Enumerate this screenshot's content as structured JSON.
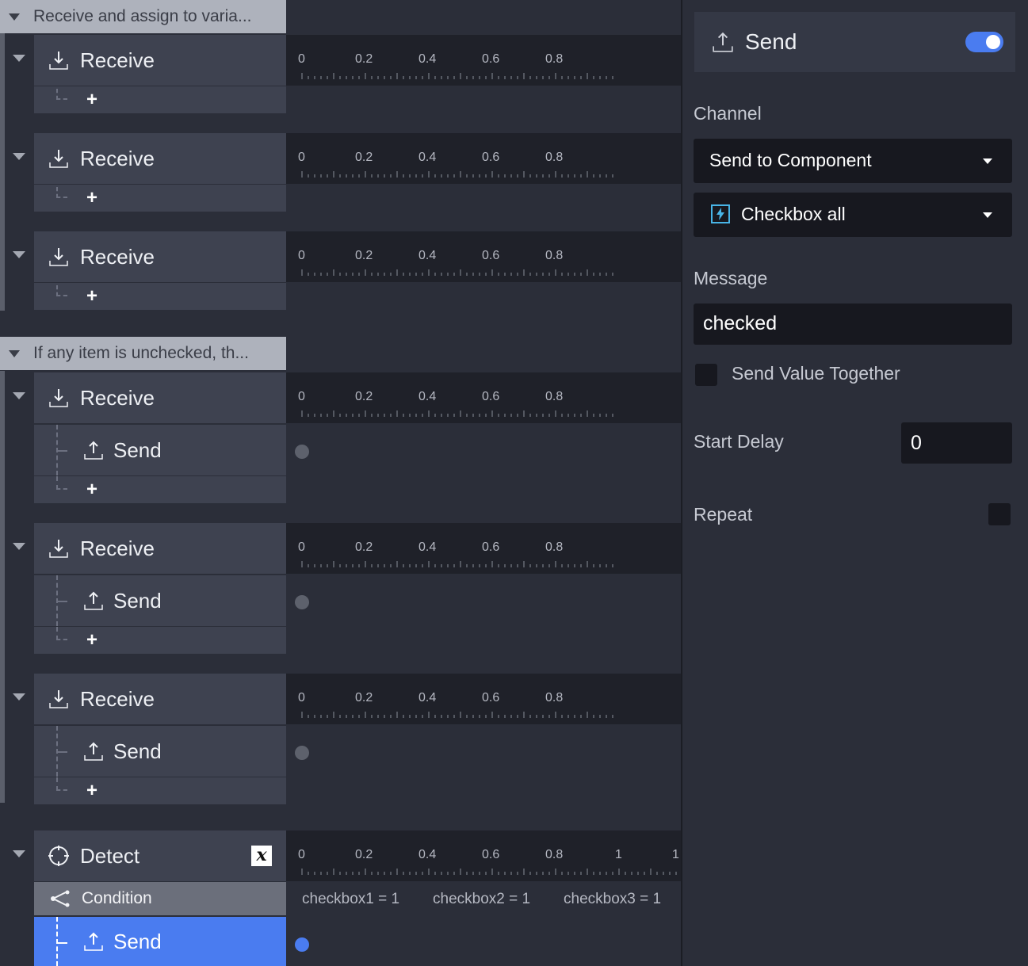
{
  "groups": [
    {
      "title": "Receive and assign to varia..."
    },
    {
      "title": "If any item is unchecked, th..."
    }
  ],
  "tracks": {
    "receive_label": "Receive",
    "send_label": "Send",
    "detect_label": "Detect",
    "condition_label": "Condition",
    "plus_label": "+"
  },
  "ruler": {
    "labels": [
      "0",
      "0.2",
      "0.4",
      "0.6",
      "0.8"
    ],
    "detect_labels": [
      "0",
      "0.2",
      "0.4",
      "0.6",
      "0.8",
      "1",
      "1"
    ]
  },
  "conditions": [
    "checkbox1 = 1",
    "checkbox2 = 1",
    "checkbox3 = 1"
  ],
  "detect_badge": "x",
  "panel": {
    "title": "Send",
    "enabled": true,
    "channel_label": "Channel",
    "channel_value": "Send to Component",
    "component_value": "Checkbox all",
    "message_label": "Message",
    "message_value": "checked",
    "send_value_together_label": "Send Value Together",
    "send_value_together": false,
    "start_delay_label": "Start Delay",
    "start_delay_value": "0",
    "repeat_label": "Repeat",
    "repeat": false
  },
  "colors": {
    "accent": "#4a7cf0",
    "background": "#2b2e39",
    "track": "#3e4250",
    "ruler": "#1f2129",
    "group_header": "#aeb2bc"
  },
  "icons": [
    "receive-icon",
    "send-icon",
    "detect-icon",
    "condition-icon",
    "lightning-icon",
    "variable-icon"
  ]
}
